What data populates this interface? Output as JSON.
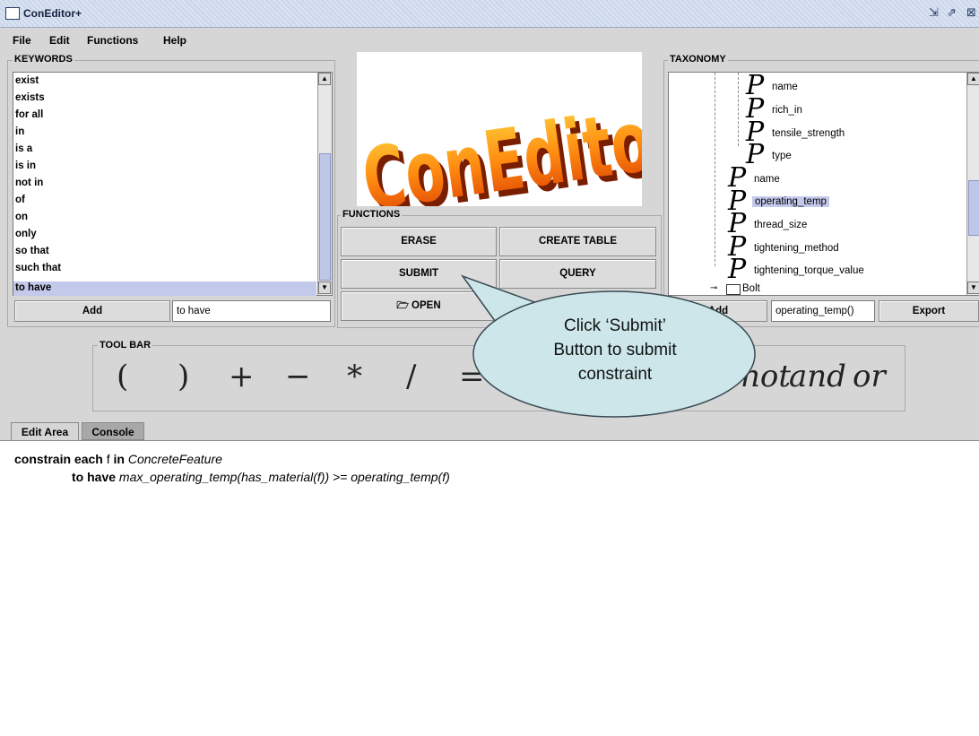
{
  "window": {
    "title": "ConEditor+"
  },
  "menu": [
    "File",
    "Edit",
    "Functions",
    "Help"
  ],
  "keywords": {
    "label": "KEYWORDS",
    "items": [
      "exist",
      "exists",
      "for all",
      "in",
      "is a",
      "is in",
      "not in",
      "of",
      "on",
      "only",
      "so that",
      "such that",
      "to have"
    ],
    "selected": "to have",
    "add_label": "Add",
    "input_value": "to have"
  },
  "logo_text": "ConEditor+",
  "functions": {
    "label": "FUNCTIONS",
    "erase": "ERASE",
    "create_table": "CREATE TABLE",
    "submit": "SUBMIT",
    "query": "QUERY",
    "open": "OPEN"
  },
  "taxonomy": {
    "label": "TAXONOMY",
    "nodes": [
      "name",
      "rich_in",
      "tensile_strength",
      "type",
      "name",
      "operating_temp",
      "thread_size",
      "tightening_method",
      "tightening_torque_value"
    ],
    "selected": "operating_temp",
    "folder": "Bolt",
    "add_label": "Add",
    "input_value": "operating_temp()",
    "export_label": "Export"
  },
  "callout": {
    "line1": "Click ‘Submit’",
    "line2": "Button to submit",
    "line3": "constraint"
  },
  "toolbar": {
    "label": "TOOL BAR",
    "symbols": [
      "(",
      ")",
      "+",
      "−",
      "*",
      "/",
      "="
    ],
    "words": [
      "not",
      "and",
      "or"
    ]
  },
  "tabs": {
    "edit_area": "Edit Area",
    "console": "Console"
  },
  "editor": {
    "kw1": "constrain each",
    "var": " f ",
    "kw2": "in",
    "type": " ConcreteFeature",
    "kw3": "to have",
    "expr": " max_operating_temp(has_material(f)) >= operating_temp(f)"
  },
  "colors": {
    "selection": "#c3c9ea",
    "callout_fill": "#cde6ea",
    "titlebar": "#c9d6ea"
  }
}
